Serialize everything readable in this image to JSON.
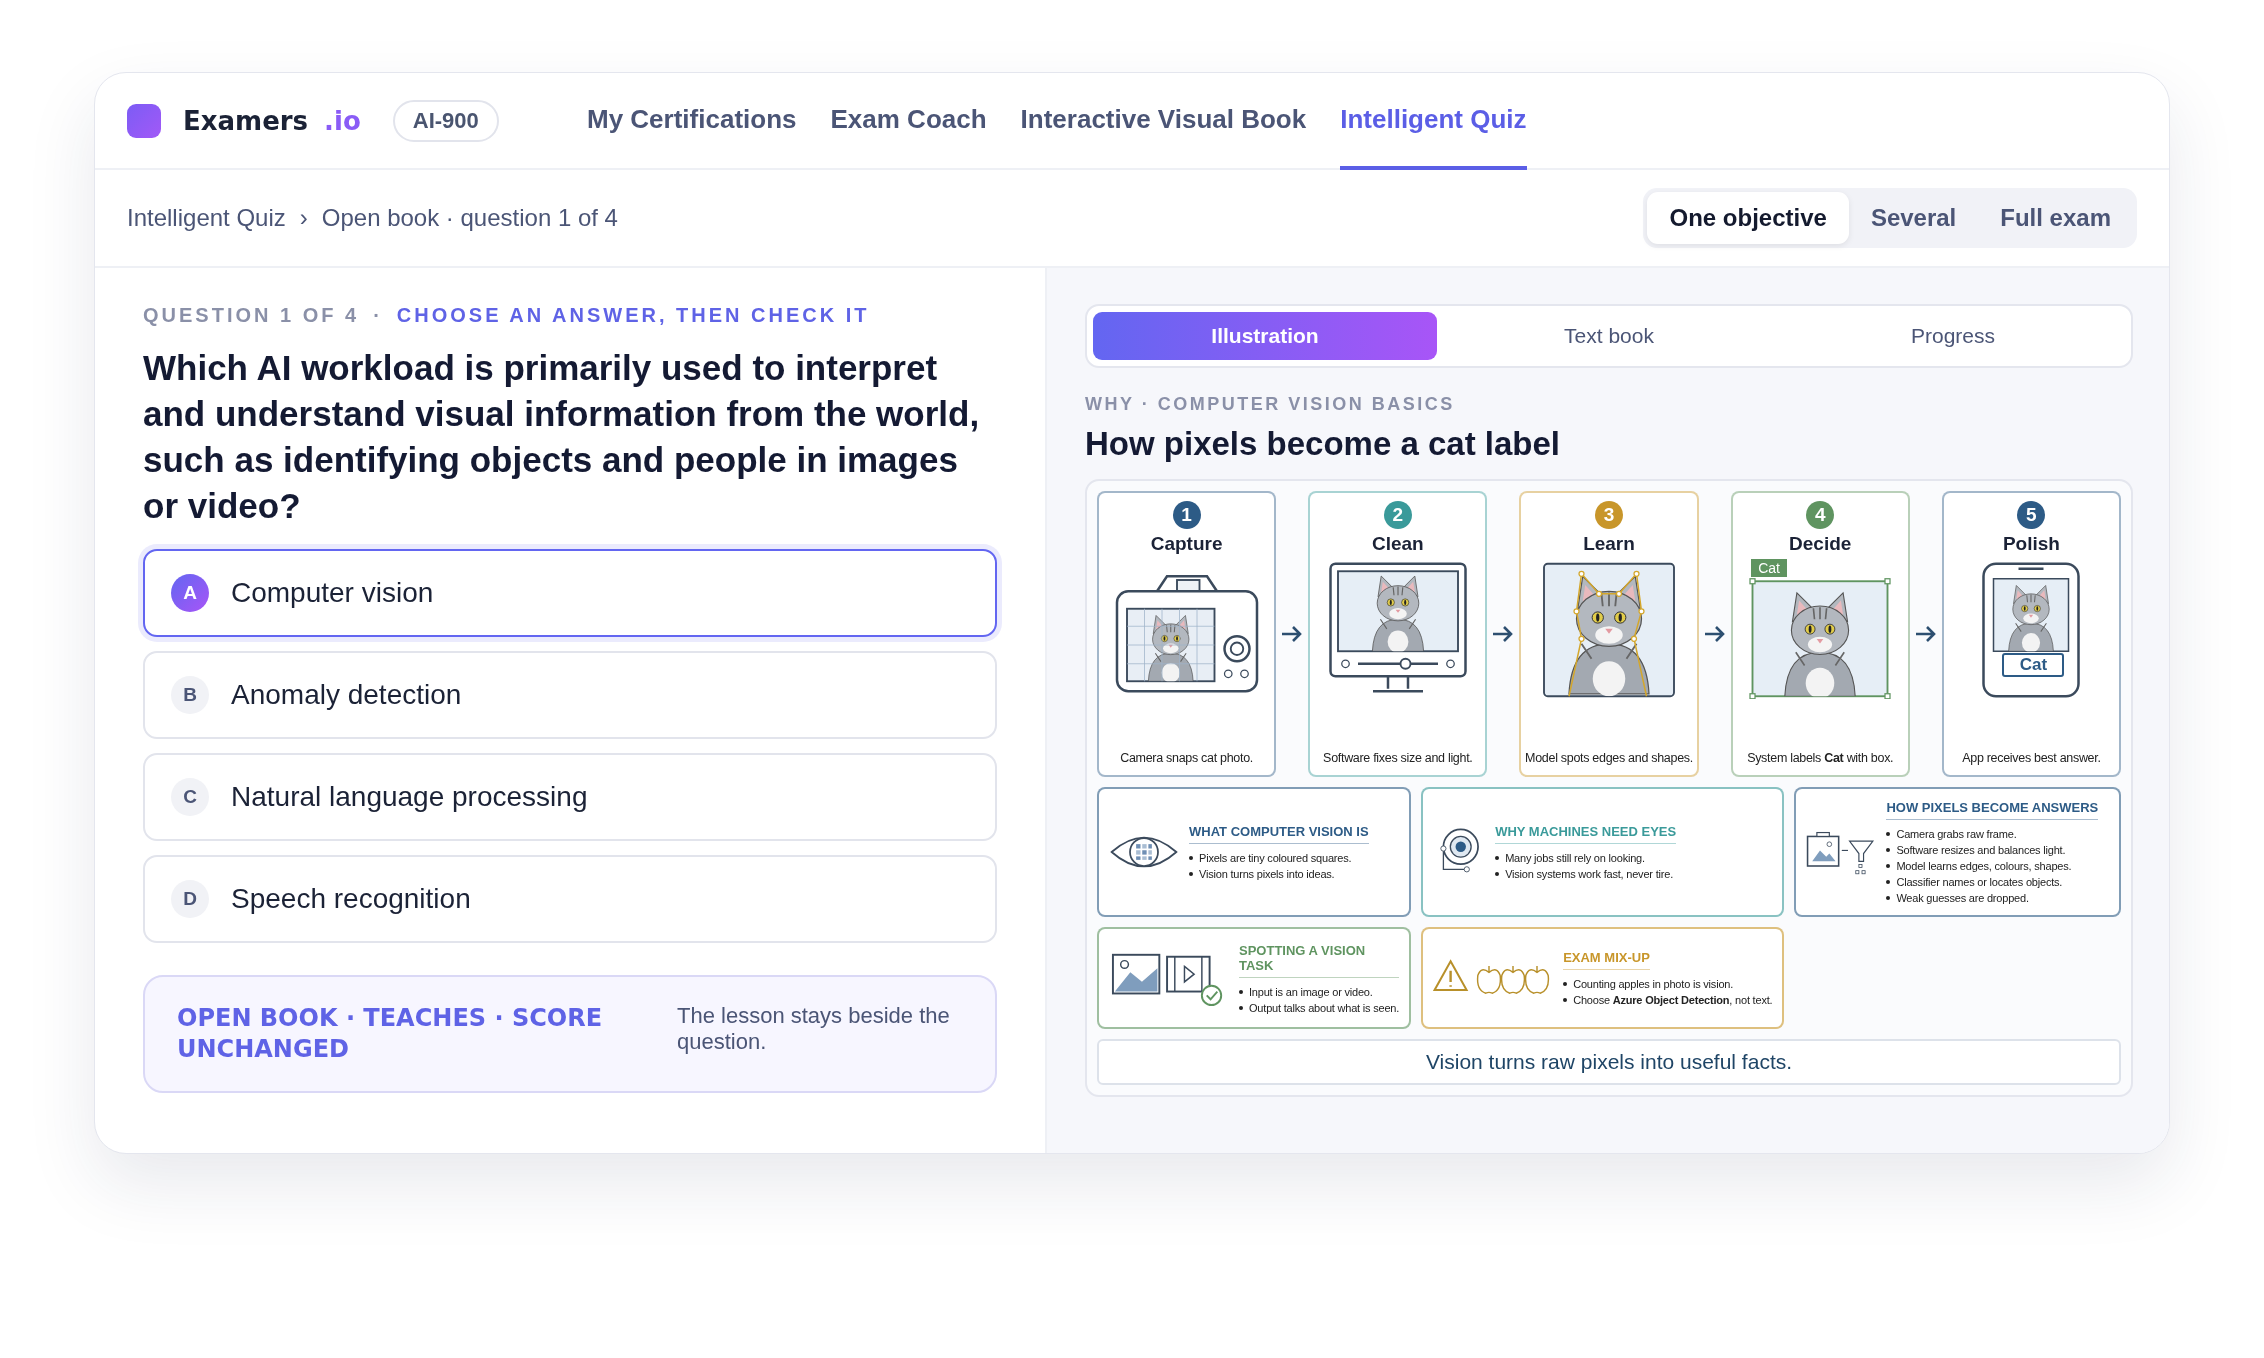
{
  "brand": {
    "name": "Examers",
    "suffix": ".io",
    "badge": "AI-900"
  },
  "nav": [
    {
      "label": "My Certifications",
      "selected": false
    },
    {
      "label": "Exam Coach",
      "selected": false
    },
    {
      "label": "Interactive Visual Book",
      "selected": false
    },
    {
      "label": "Intelligent Quiz",
      "selected": true
    }
  ],
  "breadcrumb": {
    "items": [
      "Intelligent Quiz",
      "Open book · question 1 of 4"
    ],
    "separator": "›"
  },
  "modes": [
    {
      "label": "One objective",
      "selected": true
    },
    {
      "label": "Several",
      "selected": false
    },
    {
      "label": "Full exam",
      "selected": false
    }
  ],
  "question": {
    "counter": "QUESTION 1 OF 4",
    "separator": "·",
    "instruction": "CHOOSE AN ANSWER, THEN CHECK IT",
    "text": "Which AI workload is primarily used to interpret and understand visual information from the world, such as identifying objects and people in images or video?",
    "options": [
      {
        "letter": "A",
        "text": "Computer vision",
        "selected": true
      },
      {
        "letter": "B",
        "text": "Anomaly detection",
        "selected": false
      },
      {
        "letter": "C",
        "text": "Natural language processing",
        "selected": false
      },
      {
        "letter": "D",
        "text": "Speech recognition",
        "selected": false
      }
    ]
  },
  "note": {
    "title": "OPEN BOOK · TEACHES · SCORE UNCHANGED",
    "text": "The lesson stays beside the question."
  },
  "panel": {
    "tabs": [
      {
        "label": "Illustration",
        "selected": true
      },
      {
        "label": "Text book",
        "selected": false
      },
      {
        "label": "Progress",
        "selected": false
      }
    ],
    "eyebrow": "WHY · COMPUTER VISION BASICS",
    "title": "How pixels become a cat label",
    "infographic": {
      "steps": [
        {
          "number": "1",
          "title": "Capture",
          "caption": "Camera snaps cat photo.",
          "kind": "camera",
          "color": "#2d5b86"
        },
        {
          "number": "2",
          "title": "Clean",
          "caption": "Software fixes size and light.",
          "kind": "monitor",
          "color": "#3a9a9a"
        },
        {
          "number": "3",
          "title": "Learn",
          "caption": "Model spots edges and shapes.",
          "kind": "outline",
          "color": "#c8962a"
        },
        {
          "number": "4",
          "title": "Decide",
          "caption": "System labels **Cat** with box.",
          "kind": "box",
          "color": "#5f9460",
          "tag": "Cat"
        },
        {
          "number": "5",
          "title": "Polish",
          "caption": "App receives best answer.",
          "kind": "phone",
          "color": "#2d5b86",
          "tag": "Cat"
        }
      ],
      "cards": [
        {
          "title": "WHAT COMPUTER VISION IS",
          "kind": "eye",
          "color": "#2d5b86",
          "bullets": [
            "Pixels are tiny coloured squares.",
            "Vision turns pixels into ideas."
          ]
        },
        {
          "title": "WHY MACHINES NEED EYES",
          "kind": "lens",
          "color": "#3a9a9a",
          "bullets": [
            "Many jobs still rely on looking.",
            "Vision systems work fast, never tire."
          ]
        },
        {
          "title": "HOW PIXELS BECOME ANSWERS",
          "kind": "funnel",
          "color": "#2d5b86",
          "bullets": [
            "Camera grabs raw frame.",
            "Software resizes and balances light.",
            "Model learns edges, colours, shapes.",
            "Classifier names or locates objects.",
            "Weak guesses are dropped."
          ]
        },
        {
          "title": "SPOTTING A VISION TASK",
          "kind": "media",
          "color": "#5f9460",
          "bullets": [
            "Input is an image or video.",
            "Output talks about what is seen."
          ]
        },
        {
          "title": "EXAM MIX-UP",
          "kind": "apples",
          "color": "#c8962a",
          "bullets": [
            "Counting apples in photo is vision.",
            "Choose **Azure Object Detection**, not text."
          ]
        }
      ],
      "summary": "Vision turns raw pixels into useful facts."
    }
  }
}
